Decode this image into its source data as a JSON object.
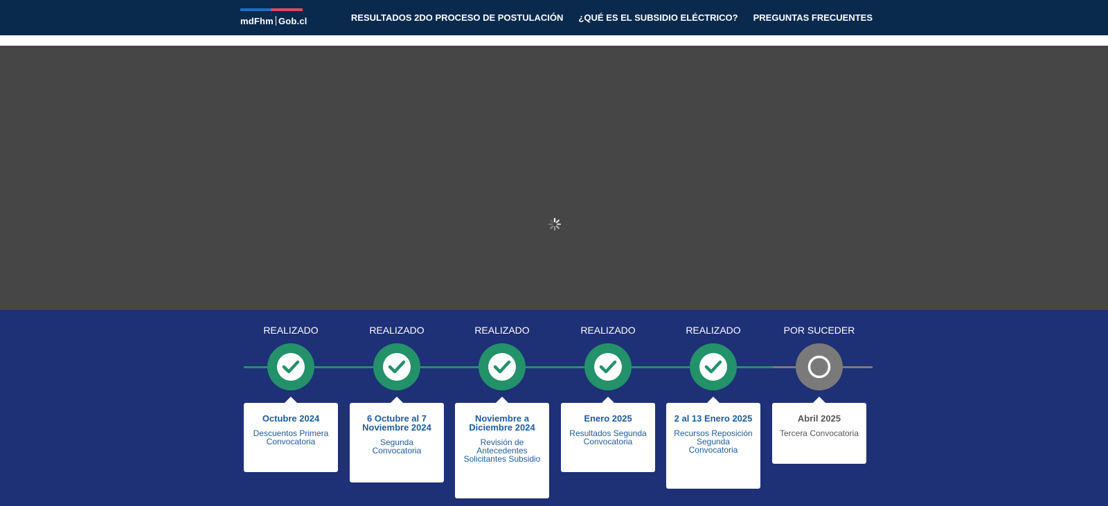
{
  "header": {
    "logo": {
      "left": "mdFhm",
      "right": "Gob.cl"
    },
    "nav": [
      {
        "label": "RESULTADOS 2DO PROCESO DE POSTULACIÓN"
      },
      {
        "label": "¿QUÉ ES EL SUBSIDIO ELÉCTRICO?"
      },
      {
        "label": "PREGUNTAS FRECUENTES"
      }
    ]
  },
  "hero": {
    "state_icon": "loading-spinner-icon"
  },
  "timeline": {
    "steps": [
      {
        "status": "REALIZADO",
        "state": "done",
        "icon": "check-icon",
        "date": "Octubre 2024",
        "desc": "Descuentos Primera Convocatoria"
      },
      {
        "status": "REALIZADO",
        "state": "done",
        "icon": "check-icon",
        "date": "6 Octubre al 7 Noviembre 2024",
        "desc": "Segunda Convocatoria"
      },
      {
        "status": "REALIZADO",
        "state": "done",
        "icon": "check-icon",
        "date": "Noviembre a Diciembre 2024",
        "desc": "Revisión de Antecedentes Solicitantes Subsidio"
      },
      {
        "status": "REALIZADO",
        "state": "done",
        "icon": "check-icon",
        "date": "Enero 2025",
        "desc": "Resultados Segunda Convocatoria"
      },
      {
        "status": "REALIZADO",
        "state": "done",
        "icon": "check-icon",
        "date": "2 al 13 Enero 2025",
        "desc": "Recursos Reposición Segunda Convocatoria"
      },
      {
        "status": "POR SUCEDER",
        "state": "pending",
        "icon": "empty-circle-icon",
        "date": "Abril 2025",
        "desc": "Tercera Convocatoria"
      }
    ]
  },
  "colors": {
    "header_bg": "#0a2a4d",
    "hero_bg": "#464646",
    "timeline_bg": "#1e3076",
    "done": "#23916a",
    "pending": "#7a7a7a",
    "card_text": "#1d5c9e"
  }
}
